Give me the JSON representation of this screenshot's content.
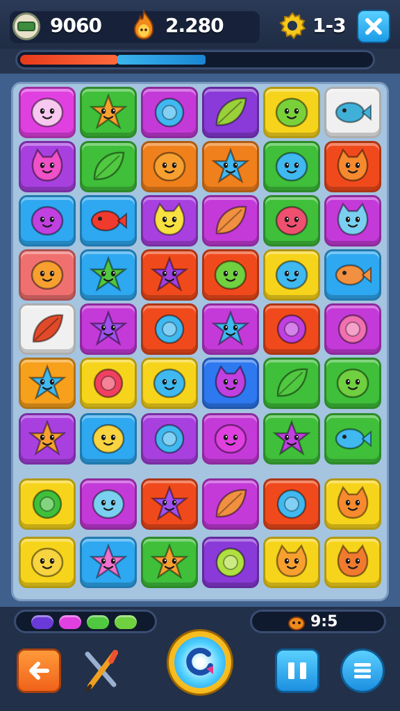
{
  "hud": {
    "score": "9060",
    "energy": "2.280",
    "level": "1-3",
    "progress_red": 0.28,
    "progress_blue": 0.25,
    "icons": [
      "coin-icon",
      "flame-icon",
      "gear-icon",
      "close-icon"
    ]
  },
  "board": {
    "rows": [
      [
        {
          "bg": "#e040e0",
          "face": "#f7c8f0",
          "shape": "blob"
        },
        {
          "bg": "#3fbf3a",
          "face": "#f7a12e",
          "shape": "star"
        },
        {
          "bg": "#c43ad8",
          "face": "#40b8f0",
          "shape": "ring"
        },
        {
          "bg": "#8a3ad8",
          "face": "#9ad03a",
          "shape": "leaf"
        },
        {
          "bg": "#f7d41c",
          "face": "#7ad03a",
          "shape": "blob"
        },
        {
          "bg": "#f0f0f0",
          "face": "#40b0d8",
          "shape": "fish"
        }
      ],
      [
        {
          "bg": "#a840e0",
          "face": "#f050c8",
          "shape": "cat"
        },
        {
          "bg": "#3fbf3a",
          "face": "#50c840",
          "shape": "leaf"
        },
        {
          "bg": "#f0801c",
          "face": "#f7a030",
          "shape": "blob"
        },
        {
          "bg": "#f0801c",
          "face": "#40b8f0",
          "shape": "star"
        },
        {
          "bg": "#3fbf3a",
          "face": "#40b8f0",
          "shape": "blob"
        },
        {
          "bg": "#f04a1c",
          "face": "#f78a2e",
          "shape": "cat"
        }
      ],
      [
        {
          "bg": "#2ea8f0",
          "face": "#c040e0",
          "shape": "blob"
        },
        {
          "bg": "#2ea8f0",
          "face": "#f03a2e",
          "shape": "fish"
        },
        {
          "bg": "#a840e0",
          "face": "#f7e040",
          "shape": "cat"
        },
        {
          "bg": "#c43ad8",
          "face": "#f09040",
          "shape": "leaf"
        },
        {
          "bg": "#3fbf3a",
          "face": "#f05070",
          "shape": "blob"
        },
        {
          "bg": "#c43ad8",
          "face": "#7ad0f0",
          "shape": "cat"
        }
      ],
      [
        {
          "bg": "#f07070",
          "face": "#f7a030",
          "shape": "blob"
        },
        {
          "bg": "#2ea8f0",
          "face": "#50c840",
          "shape": "star"
        },
        {
          "bg": "#f04a1c",
          "face": "#a040e0",
          "shape": "star"
        },
        {
          "bg": "#f04a1c",
          "face": "#70d040",
          "shape": "blob"
        },
        {
          "bg": "#f7d41c",
          "face": "#40b8f0",
          "shape": "blob"
        },
        {
          "bg": "#2ea8f0",
          "face": "#f09040",
          "shape": "fish"
        }
      ],
      [
        {
          "bg": "#f0f0f0",
          "face": "#e04a2a",
          "shape": "leaf"
        },
        {
          "bg": "#c43ad8",
          "face": "#a050f0",
          "shape": "star"
        },
        {
          "bg": "#f04a1c",
          "face": "#40b8f0",
          "shape": "ring"
        },
        {
          "bg": "#c43ad8",
          "face": "#40b8f0",
          "shape": "star"
        },
        {
          "bg": "#f04a1c",
          "face": "#c040e0",
          "shape": "ring"
        },
        {
          "bg": "#c43ad8",
          "face": "#f070b0",
          "shape": "ring"
        }
      ],
      [
        {
          "bg": "#f7a01c",
          "face": "#40b8f0",
          "shape": "star"
        },
        {
          "bg": "#f7d41c",
          "face": "#f04060",
          "shape": "ring"
        },
        {
          "bg": "#f7d41c",
          "face": "#40b8f0",
          "shape": "blob"
        },
        {
          "bg": "#2e78f0",
          "face": "#c040e0",
          "shape": "cat"
        },
        {
          "bg": "#3fbf3a",
          "face": "#50c840",
          "shape": "leaf"
        },
        {
          "bg": "#3fbf3a",
          "face": "#70d040",
          "shape": "blob"
        }
      ],
      [
        {
          "bg": "#a840e0",
          "face": "#f7a030",
          "shape": "star"
        },
        {
          "bg": "#2ea8f0",
          "face": "#f7d440",
          "shape": "blob"
        },
        {
          "bg": "#a840e0",
          "face": "#40b8f0",
          "shape": "ring"
        },
        {
          "bg": "#c43ad8",
          "face": "#e040e0",
          "shape": "blob"
        },
        {
          "bg": "#3fbf3a",
          "face": "#c040e0",
          "shape": "star"
        },
        {
          "bg": "#3fbf3a",
          "face": "#40b8f0",
          "shape": "fish"
        }
      ],
      [
        {
          "bg": "#f7d41c",
          "face": "#3fbf3a",
          "shape": "ring"
        },
        {
          "bg": "#c43ad8",
          "face": "#7ad0f0",
          "shape": "blob"
        },
        {
          "bg": "#f04a1c",
          "face": "#a050f0",
          "shape": "star"
        },
        {
          "bg": "#c43ad8",
          "face": "#f09040",
          "shape": "leaf"
        },
        {
          "bg": "#f04a1c",
          "face": "#40b8f0",
          "shape": "ring"
        },
        {
          "bg": "#f7d41c",
          "face": "#f78a2e",
          "shape": "cat"
        }
      ],
      [
        {
          "bg": "#f7d41c",
          "face": "#f7d440",
          "shape": "blob"
        },
        {
          "bg": "#2ea8f0",
          "face": "#f070d0",
          "shape": "star"
        },
        {
          "bg": "#3fbf3a",
          "face": "#f7a030",
          "shape": "star"
        },
        {
          "bg": "#8a3ad8",
          "face": "#b0e040",
          "shape": "ring"
        },
        {
          "bg": "#f7d41c",
          "face": "#f7a030",
          "shape": "cat"
        },
        {
          "bg": "#f7d41c",
          "face": "#f07a2e",
          "shape": "cat"
        }
      ]
    ]
  },
  "gems": [
    {
      "color": "#6a3ad8"
    },
    {
      "color": "#e040e0"
    },
    {
      "color": "#50c840"
    },
    {
      "color": "#70d040"
    }
  ],
  "moves": {
    "text": "9:5"
  },
  "buttons": {
    "back": "back-arrow-icon",
    "tool": "tool-icon",
    "main": "refresh-icon",
    "pause": "pause-icon",
    "menu": "menu-icon"
  }
}
